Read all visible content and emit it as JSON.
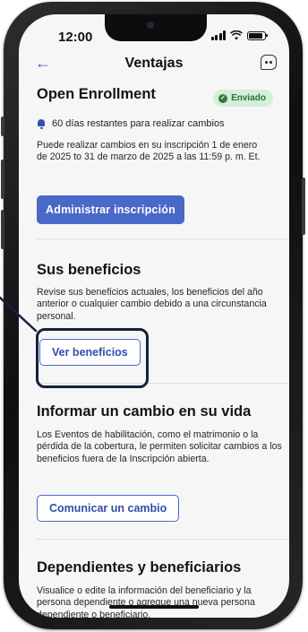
{
  "status": {
    "time": "12:00"
  },
  "nav": {
    "title": "Ventajas",
    "back_icon": "arrow-left-icon",
    "chat_icon": "chat-bot-icon"
  },
  "enrollment": {
    "title": "Open Enrollment",
    "badge": "Enviado",
    "days_notice": "60 días restantes para realizar cambios",
    "description": "Puede realizar cambios en su inscripción 1 de enero de 2025 to 31 de marzo de 2025 a las 11:59 p. m. Et.",
    "button": "Administrar inscripción"
  },
  "benefits": {
    "title": "Sus beneficios",
    "description": "Revise sus beneficios actuales, los beneficios del año anterior o cualquier cambio debido a una circunstancia personal.",
    "button": "Ver beneficios"
  },
  "life_change": {
    "title": "Informar un cambio en su vida",
    "description": "Los Eventos de habilitación, como el matrimonio o la pérdida de la cobertura, le permiten solicitar cambios a los beneficios fuera de la Inscripción abierta.",
    "button": "Comunicar un cambio"
  },
  "dependents": {
    "title": "Dependientes y beneficiarios",
    "description": "Visualice o edite la información del beneficiario y la persona dependiente o agregue una nueva persona dependiente o beneficiario."
  },
  "colors": {
    "accent": "#4a68c7",
    "badge_bg": "#d3efd6",
    "highlight": "#16213c"
  }
}
